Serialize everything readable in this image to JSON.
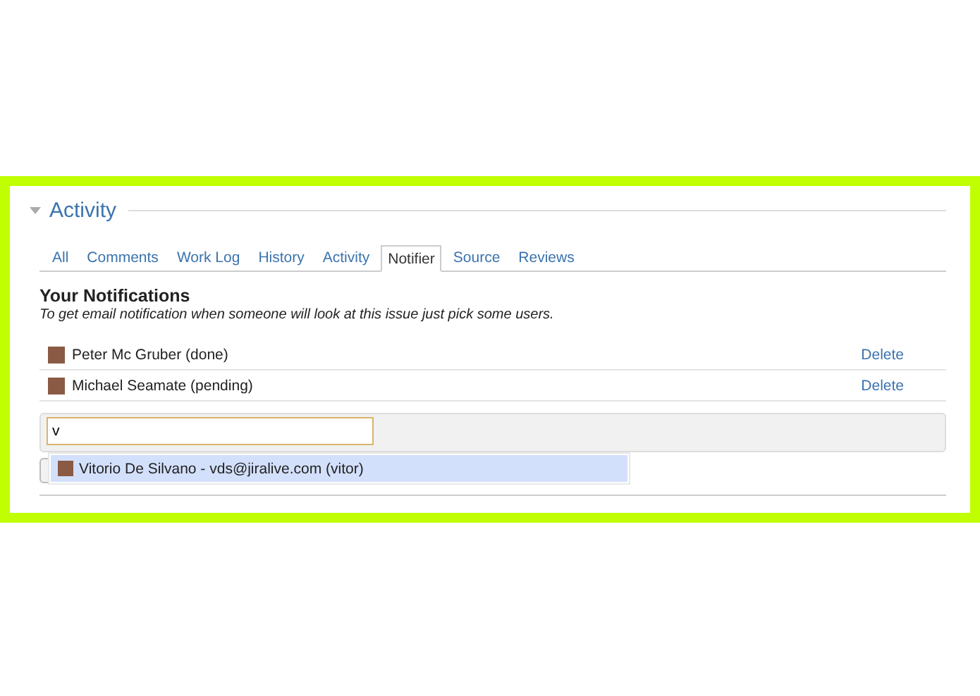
{
  "section": {
    "title": "Activity",
    "expanded": true
  },
  "tabs": [
    {
      "label": "All",
      "selected": false
    },
    {
      "label": "Comments",
      "selected": false
    },
    {
      "label": "Work Log",
      "selected": false
    },
    {
      "label": "History",
      "selected": false
    },
    {
      "label": "Activity",
      "selected": false
    },
    {
      "label": "Notifier",
      "selected": true
    },
    {
      "label": "Source",
      "selected": false
    },
    {
      "label": "Reviews",
      "selected": false
    }
  ],
  "heading": "Your Notifications",
  "description": "To get email notification when someone will look at this issue just pick some users.",
  "notifications": [
    {
      "name": "Peter Mc Gruber (done)",
      "action": "Delete"
    },
    {
      "name": "Michael Seamate (pending)",
      "action": "Delete"
    }
  ],
  "user_search": {
    "value": "v",
    "suggestions": [
      {
        "label": "Vitorio De Silvano - vds@jiralive.com (vitor)",
        "selected": true
      }
    ]
  }
}
